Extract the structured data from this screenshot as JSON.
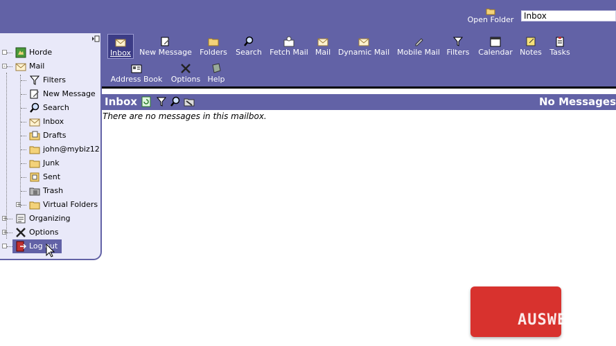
{
  "header": {
    "open_folder_label": "Open Folder",
    "folder_select_value": "Inbox"
  },
  "sidebar": {
    "items": [
      {
        "label": "Horde",
        "icon": "horde-icon"
      },
      {
        "label": "Mail",
        "icon": "mail-icon"
      },
      {
        "label": "Filters",
        "icon": "filter-icon"
      },
      {
        "label": "New Message",
        "icon": "compose-icon"
      },
      {
        "label": "Search",
        "icon": "search-icon"
      },
      {
        "label": "Inbox",
        "icon": "inbox-icon"
      },
      {
        "label": "Drafts",
        "icon": "drafts-icon"
      },
      {
        "label": "john@mybiz12",
        "icon": "folder-icon"
      },
      {
        "label": "Junk",
        "icon": "folder-icon"
      },
      {
        "label": "Sent",
        "icon": "sent-icon"
      },
      {
        "label": "Trash",
        "icon": "trash-icon"
      },
      {
        "label": "Virtual Folders",
        "icon": "folder-icon"
      },
      {
        "label": "Organizing",
        "icon": "organizing-icon"
      },
      {
        "label": "Options",
        "icon": "options-icon"
      },
      {
        "label": "Log out",
        "icon": "logout-icon"
      }
    ]
  },
  "toolbar": {
    "items": [
      {
        "label": "Inbox",
        "icon": "inbox-icon"
      },
      {
        "label": "New Message",
        "icon": "compose-icon"
      },
      {
        "label": "Folders",
        "icon": "folder-icon"
      },
      {
        "label": "Search",
        "icon": "search-icon"
      },
      {
        "label": "Fetch Mail",
        "icon": "fetch-mail-icon"
      },
      {
        "label": "Mail",
        "icon": "mail-icon"
      },
      {
        "label": "Dynamic Mail",
        "icon": "dynamic-mail-icon"
      },
      {
        "label": "Mobile Mail",
        "icon": "mobile-mail-icon"
      },
      {
        "label": "Filters",
        "icon": "filter-icon"
      },
      {
        "label": "Calendar",
        "icon": "calendar-icon"
      },
      {
        "label": "Notes",
        "icon": "notes-icon"
      },
      {
        "label": "Tasks",
        "icon": "tasks-icon"
      },
      {
        "label": "Address Book",
        "icon": "address-book-icon"
      },
      {
        "label": "Options",
        "icon": "options-icon"
      },
      {
        "label": "Help",
        "icon": "help-icon"
      }
    ]
  },
  "mailbox": {
    "title": "Inbox",
    "status": "No Messages",
    "empty_message": "There are no messages in this mailbox."
  },
  "watermark": {
    "text": "AUSWEB"
  },
  "colors": {
    "header_bg": "#6262a6",
    "sidebar_bg": "#e9e9f9",
    "watermark_bg": "#d8322e"
  }
}
